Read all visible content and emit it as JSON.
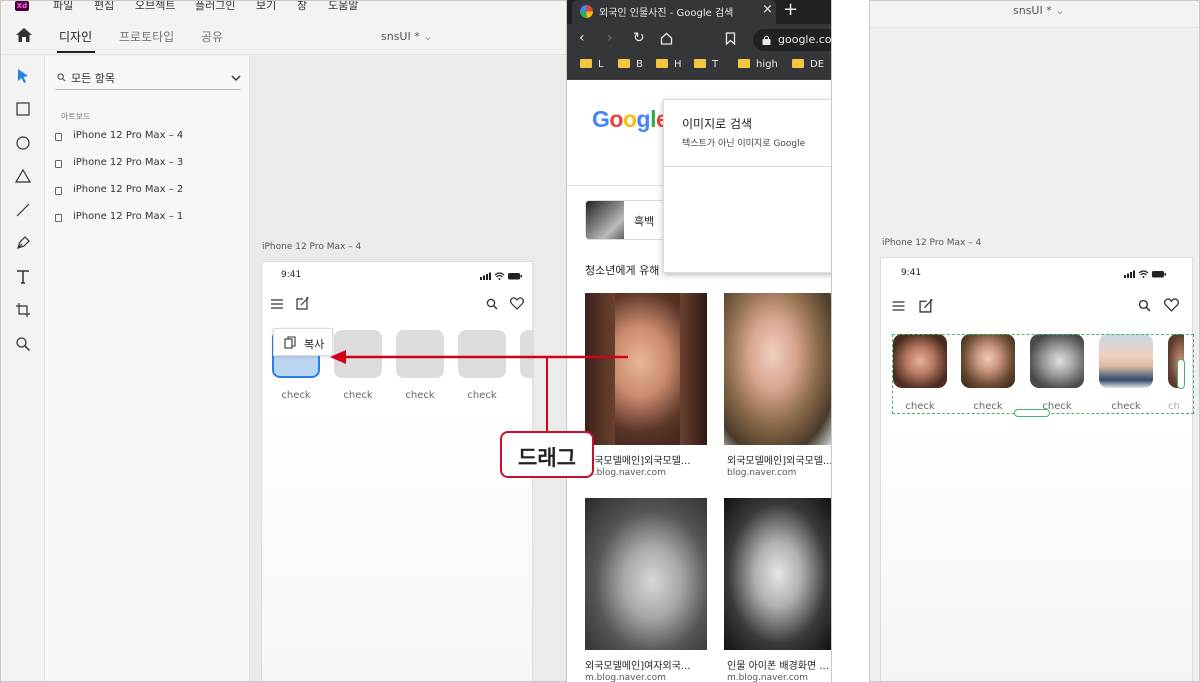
{
  "xd_window": {
    "app_logo": "Xd",
    "menu": [
      "파일",
      "편집",
      "오브젝트",
      "플러그인",
      "보기",
      "창",
      "도움말"
    ],
    "tabs": [
      "디자인",
      "프로토타입",
      "공유"
    ],
    "active_tab": "디자인",
    "document_title": "snsUI *",
    "layers_search": "모든 항목",
    "layers_heading": "아트보드",
    "artboards": [
      "iPhone 12 Pro Max – 4",
      "iPhone 12 Pro Max – 3",
      "iPhone 12 Pro Max – 2",
      "iPhone 12 Pro Max – 1"
    ],
    "artboard_label": "iPhone 12 Pro Max – 4",
    "status_time": "9:41",
    "thumb_labels": [
      "check",
      "check",
      "check",
      "check"
    ],
    "copy_tooltip": "복사",
    "accent_color": "#2680eb"
  },
  "chrome_window": {
    "tab_title": "외국인 인물사진 - Google 검색",
    "url": "google.com",
    "bookmarks": [
      "L",
      "B",
      "H",
      "T",
      "high",
      "DE"
    ],
    "logo_text": "Google",
    "popup_title": "이미지로 검색",
    "popup_subtitle": "텍스트가 아닌 이미지로 Google",
    "chip_label": "흑백",
    "section_text": "청소년에게 유해",
    "results": [
      {
        "caption": "외국모델메인]외국모델...",
        "source": "m.blog.naver.com"
      },
      {
        "caption": "외국모델메인]외국모델...",
        "source": "blog.naver.com"
      },
      {
        "caption": "외국모델메인]여자외국...",
        "source": "m.blog.naver.com"
      },
      {
        "caption": "인물 아이폰 배경화면 ...",
        "source": "m.blog.naver.com"
      }
    ]
  },
  "preview_window": {
    "document_title": "snsUI *",
    "artboard_label": "iPhone 12 Pro Max – 4",
    "status_time": "9:41",
    "face_labels": [
      "check",
      "check",
      "check",
      "check",
      "ch"
    ],
    "selection_color": "#45b36b"
  },
  "annotation": {
    "drag_label": "드래그",
    "arrow_color": "#d0021b"
  }
}
